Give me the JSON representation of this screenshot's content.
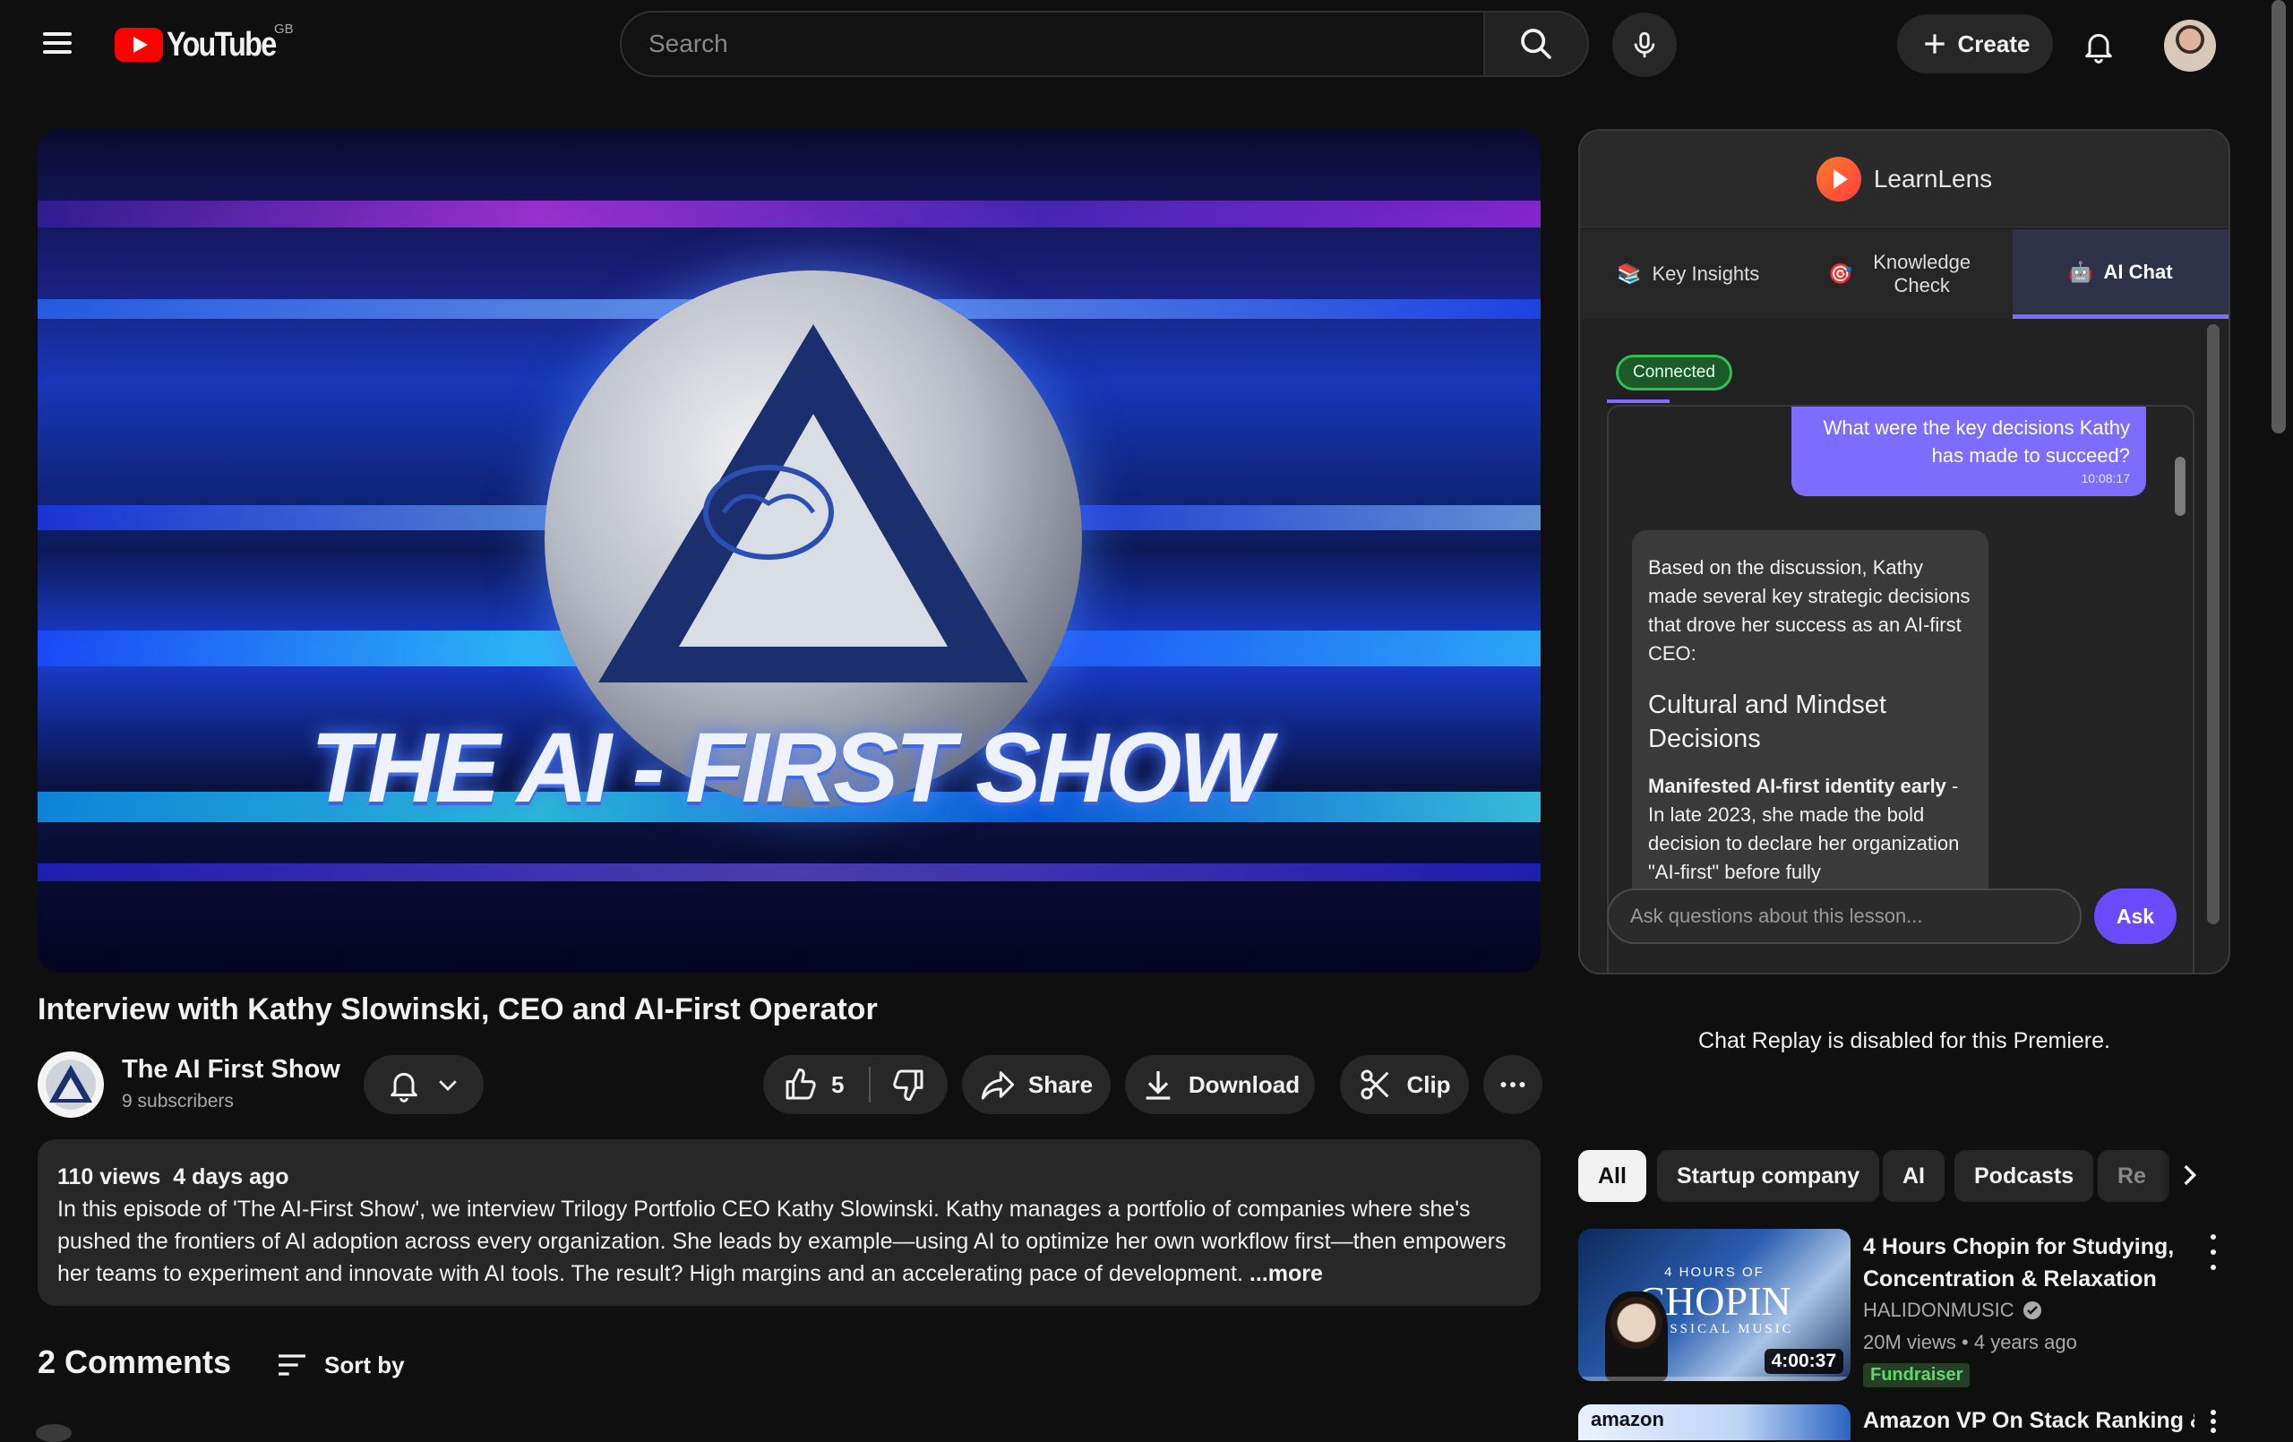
{
  "header": {
    "logo_text": "YouTube",
    "region": "GB",
    "search_placeholder": "Search",
    "create_label": "Create"
  },
  "video": {
    "title": "Interview with Kathy Slowinski, CEO and AI-First Operator",
    "thumbnail_text": "THE AI - FIRST SHOW"
  },
  "channel": {
    "name": "The AI First Show",
    "subscribers": "9 subscribers"
  },
  "actions": {
    "like_count": "5",
    "share": "Share",
    "download": "Download",
    "clip": "Clip"
  },
  "description": {
    "views": "110 views",
    "age": "4 days ago",
    "text": "In this episode of 'The AI-First Show', we interview Trilogy Portfolio CEO Kathy Slowinski. Kathy manages a portfolio of companies where she's pushed the frontiers of AI adoption across every organization. She leads by example—using AI to optimize her own workflow first—then empowers her teams to experiment and innovate with AI tools. The result? High margins and an accelerating pace of development.",
    "more": "...more"
  },
  "comments": {
    "title": "2 Comments",
    "sort_label": "Sort by"
  },
  "learnlens": {
    "brand": "LearnLens",
    "tabs": [
      {
        "label": "Key Insights",
        "icon": "books-icon"
      },
      {
        "label": "Knowledge Check",
        "icon": "target-icon"
      },
      {
        "label": "AI Chat",
        "icon": "robot-icon",
        "active": true
      }
    ],
    "status": "Connected",
    "messages": {
      "user_text": "What were the key decisions Kathy has made to succeed?",
      "user_time": "10:08:17",
      "ai_intro": "Based on the discussion, Kathy made several key strategic decisions that drove her success as an AI-first CEO:",
      "ai_heading": "Cultural and Mindset Decisions",
      "ai_point_bold": "Manifested AI-first identity early",
      "ai_point_text": " - In late 2023, she made the bold decision to declare her organization \"AI-first\" before fully"
    },
    "input_placeholder": "Ask questions about this lesson...",
    "ask_label": "Ask"
  },
  "chat_replay_notice": "Chat Replay is disabled for this Premiere.",
  "chips": [
    "All",
    "Startup company",
    "AI",
    "Podcasts",
    "Re"
  ],
  "recommendations": [
    {
      "title": "4 Hours Chopin for Studying, Concentration & Relaxation",
      "channel": "HALIDONMUSIC",
      "meta": "20M views • 4 years ago",
      "badge": "Fundraiser",
      "duration": "4:00:37",
      "thumb_line1": "4 HOURS OF",
      "thumb_line2": "CHOPIN",
      "thumb_line3": "CLASSICAL MUSIC"
    },
    {
      "title": "Amazon VP On Stack Ranking &",
      "thumb_text": "amazon"
    }
  ],
  "colors": {
    "brand_red": "#ff0000",
    "accent_purple": "#7e6bff",
    "connected_green": "#2fbf57"
  }
}
